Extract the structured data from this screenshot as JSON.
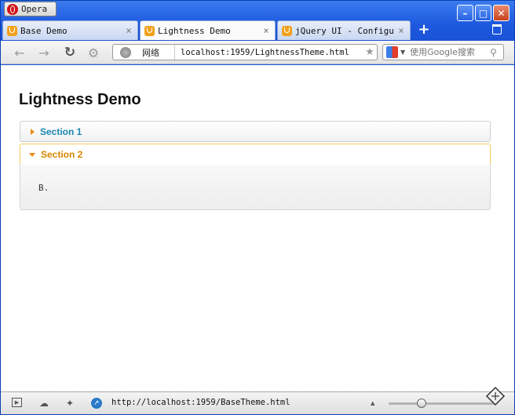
{
  "window": {
    "menu_button_label": "Opera",
    "buttons": {
      "minimize": "–",
      "maximize": "□",
      "close": "✕"
    }
  },
  "tabs": [
    {
      "label": "Base Demo",
      "close": "×"
    },
    {
      "label": "Lightness Demo",
      "close": "×"
    },
    {
      "label": "jQuery UI - Configu...",
      "close": "×"
    }
  ],
  "new_tab_label": "+",
  "address_bar": {
    "network_label": "网络",
    "url": "localhost:1959/LightnessTheme.html"
  },
  "search": {
    "placeholder": "使用Google搜索"
  },
  "page": {
    "title": "Lightness Demo",
    "accordion": [
      {
        "header": "Section 1",
        "expanded": false
      },
      {
        "header": "Section 2",
        "expanded": true,
        "content": "B."
      }
    ]
  },
  "status_bar": {
    "url": "http://localhost:1959/BaseTheme.html"
  },
  "colors": {
    "window_blue": "#1c56df",
    "accordion_link": "#1b87b3",
    "accordion_active": "#d98600",
    "accordion_active_border": "#f6c85f"
  }
}
